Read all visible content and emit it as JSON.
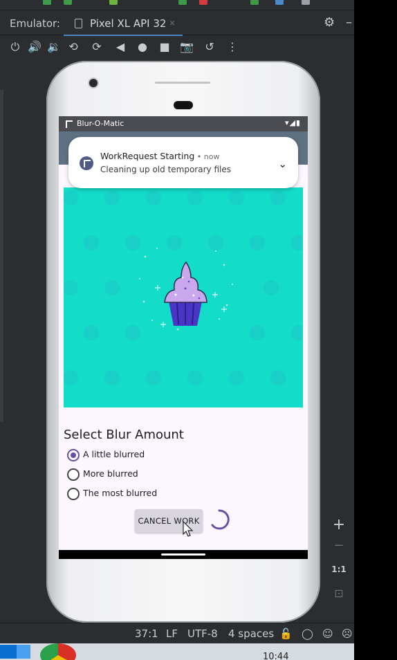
{
  "ide": {
    "emulator_label": "Emulator:",
    "device_tab": "Pixel XL API 32",
    "tab_close": "×",
    "toolbar_icons": [
      "power-icon",
      "volume-up-icon",
      "volume-down-icon",
      "rotate-left-icon",
      "rotate-right-icon",
      "back-icon",
      "home-icon",
      "overview-icon",
      "camera-icon",
      "snapshot-icon",
      "more-icon"
    ],
    "side_zoom": {
      "plus": "+",
      "minus": "−",
      "ratio": "1:1"
    },
    "status": {
      "position": "37:1",
      "line_ending": "LF",
      "encoding": "UTF-8",
      "indent": "4 spaces"
    },
    "clock": "10:44"
  },
  "phone": {
    "status_bar": {
      "app_name": "Blur-O-Matic",
      "icons": "▾◢▮"
    },
    "notification": {
      "title": "WorkRequest Starting",
      "time": " • now",
      "body": "Cleaning up old temporary files",
      "expand_glyph": "⌄"
    },
    "image_colors": {
      "background": "#13dcc8",
      "frosting": "#c9a8ee",
      "cup": "#4a35c7"
    },
    "select_title": "Select Blur Amount",
    "options": [
      {
        "label": "A little blurred",
        "selected": true
      },
      {
        "label": "More blurred",
        "selected": false
      },
      {
        "label": "The most blurred",
        "selected": false
      }
    ],
    "cancel_button": "CANCEL WORK",
    "accent": "#6750a4"
  }
}
